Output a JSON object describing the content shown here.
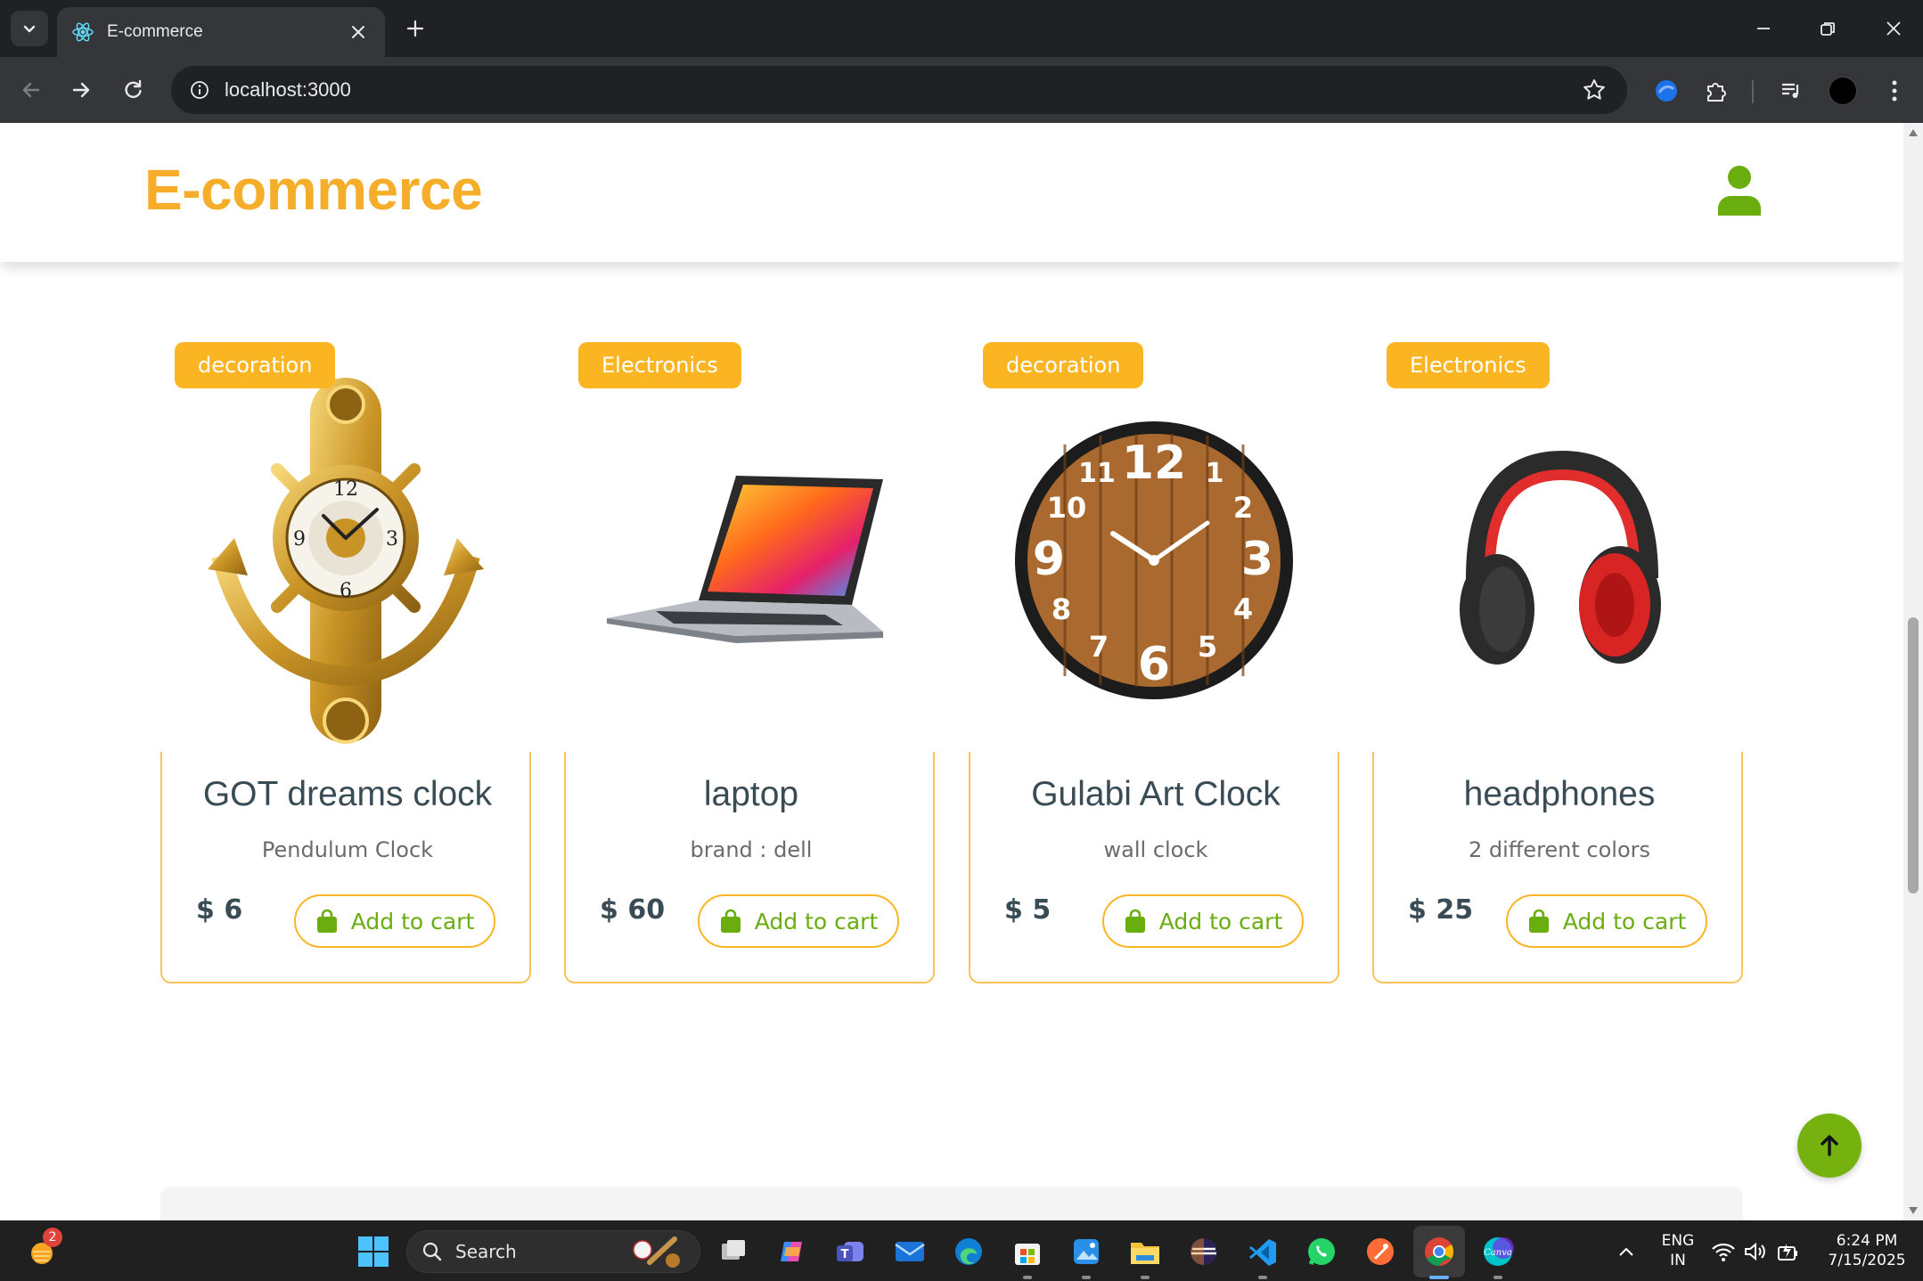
{
  "browser": {
    "tab_title": "E-commerce",
    "url": "localhost:3000"
  },
  "site": {
    "logo": "E-commerce",
    "accent_color": "#f5ad2a",
    "green_color": "#6aad0e"
  },
  "products": [
    {
      "category": "decoration",
      "name": "GOT dreams clock",
      "description": "Pendulum Clock",
      "price": "$ 6",
      "button": "Add to cart",
      "image": "anchor-pendulum-clock"
    },
    {
      "category": "Electronics",
      "name": "laptop",
      "description": "brand : dell",
      "price": "$ 60",
      "button": "Add to cart",
      "image": "laptop"
    },
    {
      "category": "decoration",
      "name": "Gulabi Art Clock",
      "description": "wall clock",
      "price": "$ 5",
      "button": "Add to cart",
      "image": "wooden-wall-clock"
    },
    {
      "category": "Electronics",
      "name": "headphones",
      "description": "2 different colors",
      "price": "$ 25",
      "button": "Add to cart",
      "image": "red-headphones"
    }
  ],
  "taskbar": {
    "search_placeholder": "Search",
    "notification_count": "2",
    "language": "ENG",
    "region": "IN",
    "time": "6:24 PM",
    "date": "7/15/2025"
  }
}
